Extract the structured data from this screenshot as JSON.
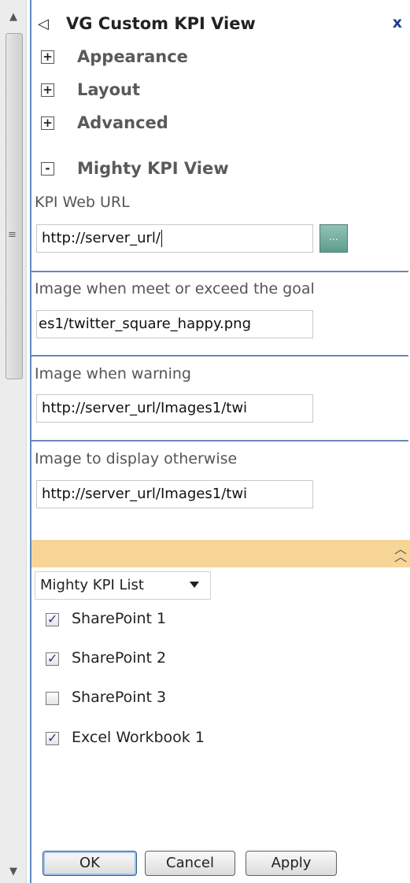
{
  "scrollbar": {
    "up_icon": "scroll-up-arrow",
    "down_icon": "scroll-down-arrow",
    "grip_icon": "grip-lines"
  },
  "title": {
    "text": "VG Custom KPI View",
    "close_glyph": "x"
  },
  "sections": [
    {
      "label": "Appearance",
      "state": "+"
    },
    {
      "label": "Layout",
      "state": "+"
    },
    {
      "label": "Advanced",
      "state": "+"
    },
    {
      "label": "Mighty KPI View",
      "state": "-"
    }
  ],
  "fields": {
    "kpi_url": {
      "label": "KPI Web URL",
      "value": "http://server_url/",
      "browse_label": "..."
    },
    "image_meet": {
      "label": "Image when meet or exceed the goal",
      "value": "es1/twitter_square_happy.png"
    },
    "image_warning": {
      "label": "Image when warning",
      "value": "http://server_url/Images1/twi"
    },
    "image_otherwise": {
      "label": "Image to display otherwise",
      "value": "http://server_url/Images1/twi"
    }
  },
  "list_selector": {
    "selected": "Mighty KPI List"
  },
  "checkboxes": [
    {
      "label": "SharePoint 1",
      "checked": true
    },
    {
      "label": "SharePoint 2",
      "checked": true
    },
    {
      "label": "SharePoint 3",
      "checked": false
    },
    {
      "label": "Excel Workbook 1",
      "checked": true
    }
  ],
  "buttons": {
    "ok": "OK",
    "cancel": "Cancel",
    "apply": "Apply"
  },
  "colors": {
    "accent_border": "#5a8cc0",
    "divider": "#6b86b8",
    "header_band": "#f7d597",
    "close_icon": "#1a3d8f"
  }
}
